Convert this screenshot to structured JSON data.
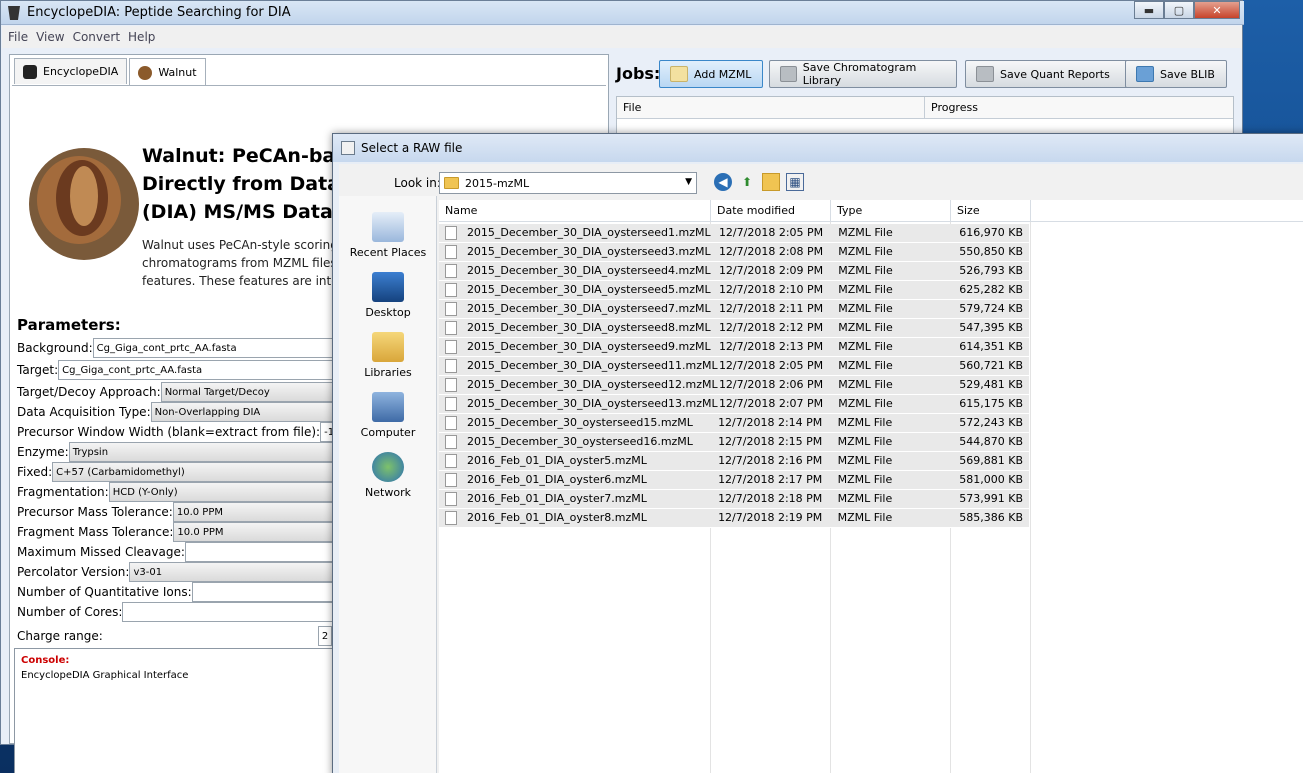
{
  "window": {
    "title": "EncyclopeDIA: Peptide Searching for DIA",
    "min_label": "▬",
    "max_label": "▢",
    "close_label": "✕"
  },
  "menu": [
    "File",
    "View",
    "Convert",
    "Help"
  ],
  "tabs": [
    {
      "label": "EncyclopeDIA",
      "icon": "encyclopedia-icon"
    },
    {
      "label": "Walnut",
      "icon": "walnut-icon"
    }
  ],
  "walnut": {
    "heading_lines": [
      "Walnut: PeCAn-based Peptide Detection",
      "Directly from Data-I",
      "(DIA) MS/MS Data"
    ],
    "desc_lines": [
      "Walnut uses PeCAn-style scoring",
      "chromatograms from MZML files,",
      "features. These features are interp"
    ]
  },
  "params": {
    "title": "Parameters:",
    "rows": [
      {
        "label": "Background:",
        "value": "Cg_Giga_cont_prtc_AA.fasta"
      },
      {
        "label": "Target:",
        "value": "Cg_Giga_cont_prtc_AA.fasta"
      },
      {
        "label": "Target/Decoy Approach:",
        "value": "Normal Target/Decoy"
      },
      {
        "label": "Data Acquisition Type:",
        "value": "Non-Overlapping DIA"
      },
      {
        "label": "Precursor Window Width (blank=extract from file):",
        "value": "-1"
      },
      {
        "label": "Enzyme:",
        "value": "Trypsin"
      },
      {
        "label": "Fixed:",
        "value": "C+57 (Carbamidomethyl)"
      },
      {
        "label": "Fragmentation:",
        "value": "HCD (Y-Only)"
      },
      {
        "label": "Precursor Mass Tolerance:",
        "value": "10.0 PPM"
      },
      {
        "label": "Fragment Mass Tolerance:",
        "value": "10.0 PPM"
      },
      {
        "label": "Maximum Missed Cleavage:",
        "value": ""
      },
      {
        "label": "Percolator Version:",
        "value": "v3-01"
      },
      {
        "label": "Number of Quantitative Ions:",
        "value": ""
      },
      {
        "label": "Number of Cores:",
        "value": ""
      },
      {
        "label": "Charge range:",
        "value": "2"
      }
    ]
  },
  "console": {
    "title": "Console:",
    "text": "EncyclopeDIA Graphical Interface"
  },
  "jobs": {
    "label": "Jobs:",
    "buttons": [
      "Add MZML",
      "Save Chromatogram Library",
      "Save Quant Reports",
      "Save BLIB"
    ],
    "columns": [
      "File",
      "Progress"
    ]
  },
  "dialog": {
    "title": "Select a RAW file",
    "lookin_label": "Look in:",
    "lookin_value": "2015-mzML",
    "places": [
      "Recent Places",
      "Desktop",
      "Libraries",
      "Computer",
      "Network"
    ],
    "columns": [
      "Name",
      "Date modified",
      "Type",
      "Size"
    ],
    "files": [
      {
        "name": "2015_December_30_DIA_oysterseed1.mzML",
        "date": "12/7/2018 2:05 PM",
        "type": "MZML File",
        "size": "616,970 KB"
      },
      {
        "name": "2015_December_30_DIA_oysterseed3.mzML",
        "date": "12/7/2018 2:08 PM",
        "type": "MZML File",
        "size": "550,850 KB"
      },
      {
        "name": "2015_December_30_DIA_oysterseed4.mzML",
        "date": "12/7/2018 2:09 PM",
        "type": "MZML File",
        "size": "526,793 KB"
      },
      {
        "name": "2015_December_30_DIA_oysterseed5.mzML",
        "date": "12/7/2018 2:10 PM",
        "type": "MZML File",
        "size": "625,282 KB"
      },
      {
        "name": "2015_December_30_DIA_oysterseed7.mzML",
        "date": "12/7/2018 2:11 PM",
        "type": "MZML File",
        "size": "579,724 KB"
      },
      {
        "name": "2015_December_30_DIA_oysterseed8.mzML",
        "date": "12/7/2018 2:12 PM",
        "type": "MZML File",
        "size": "547,395 KB"
      },
      {
        "name": "2015_December_30_DIA_oysterseed9.mzML",
        "date": "12/7/2018 2:13 PM",
        "type": "MZML File",
        "size": "614,351 KB"
      },
      {
        "name": "2015_December_30_DIA_oysterseed11.mzML",
        "date": "12/7/2018 2:05 PM",
        "type": "MZML File",
        "size": "560,721 KB"
      },
      {
        "name": "2015_December_30_DIA_oysterseed12.mzML",
        "date": "12/7/2018 2:06 PM",
        "type": "MZML File",
        "size": "529,481 KB"
      },
      {
        "name": "2015_December_30_DIA_oysterseed13.mzML",
        "date": "12/7/2018 2:07 PM",
        "type": "MZML File",
        "size": "615,175 KB"
      },
      {
        "name": "2015_December_30_oysterseed15.mzML",
        "date": "12/7/2018 2:14 PM",
        "type": "MZML File",
        "size": "572,243 KB"
      },
      {
        "name": "2015_December_30_oysterseed16.mzML",
        "date": "12/7/2018 2:15 PM",
        "type": "MZML File",
        "size": "544,870 KB"
      },
      {
        "name": "2016_Feb_01_DIA_oyster5.mzML",
        "date": "12/7/2018 2:16 PM",
        "type": "MZML File",
        "size": "569,881 KB"
      },
      {
        "name": "2016_Feb_01_DIA_oyster6.mzML",
        "date": "12/7/2018 2:17 PM",
        "type": "MZML File",
        "size": "581,000 KB"
      },
      {
        "name": "2016_Feb_01_DIA_oyster7.mzML",
        "date": "12/7/2018 2:18 PM",
        "type": "MZML File",
        "size": "573,991 KB"
      },
      {
        "name": "2016_Feb_01_DIA_oyster8.mzML",
        "date": "12/7/2018 2:19 PM",
        "type": "MZML File",
        "size": "585,386 KB"
      }
    ]
  }
}
